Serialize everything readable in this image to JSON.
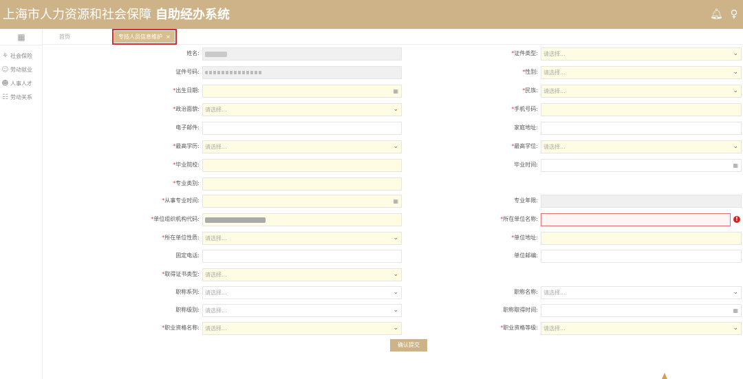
{
  "header": {
    "org": "上海市人力资源和社会保障",
    "system": "自助经办系统",
    "bell_icon": "bell-icon",
    "user_icon": "user-icon"
  },
  "sidebar": {
    "grid_icon": "grid-icon",
    "items": [
      {
        "label": "社会保险",
        "icon": "shield-icon"
      },
      {
        "label": "劳动就业",
        "icon": "person-icon"
      },
      {
        "label": "人事人才",
        "icon": "people-icon"
      },
      {
        "label": "劳动关系",
        "icon": "document-icon"
      }
    ]
  },
  "tabs": {
    "home": "首页",
    "active": "专技人员信息维护",
    "close": "×"
  },
  "form": {
    "placeholder_select": "请选择...",
    "name_label": "姓名:",
    "id_type_label": "证件类型:",
    "id_no_label": "证件号码:",
    "gender_label": "性别:",
    "birth_label": "出生日期:",
    "ethnic_label": "民族:",
    "political_label": "政治面貌:",
    "mobile_label": "手机号码:",
    "email_label": "电子邮件:",
    "address_label": "家庭地址:",
    "edu_label": "最高学历:",
    "degree_label": "最高学位:",
    "school_label": "毕业院校:",
    "grad_time_label": "毕业时间:",
    "major_label": "专业类别:",
    "work_since_label": "从事专业时间:",
    "work_years_label": "专业年限:",
    "org_code_label": "单位组织机构代码:",
    "org_name_label": "所在单位名称:",
    "org_nature_label": "所在单位性质:",
    "org_addr_label": "单位地址:",
    "phone_label": "固定电话:",
    "postcode_label": "单位邮编:",
    "cert_type_label": "取得证书类型:",
    "title_series_label": "职称系列:",
    "title_name_label": "职称名称:",
    "title_level_label": "职称级别:",
    "title_time_label": "职称取得时间:",
    "qual_name_label": "职业资格名称:",
    "qual_level_label": "职业资格等级:",
    "submit": "确认提交",
    "error_mark": "!",
    "chevron": "⌄",
    "calendar": "▦"
  },
  "colors": {
    "brand": "#cdb387",
    "required_bg": "#fefde3",
    "error": "#e02020"
  }
}
